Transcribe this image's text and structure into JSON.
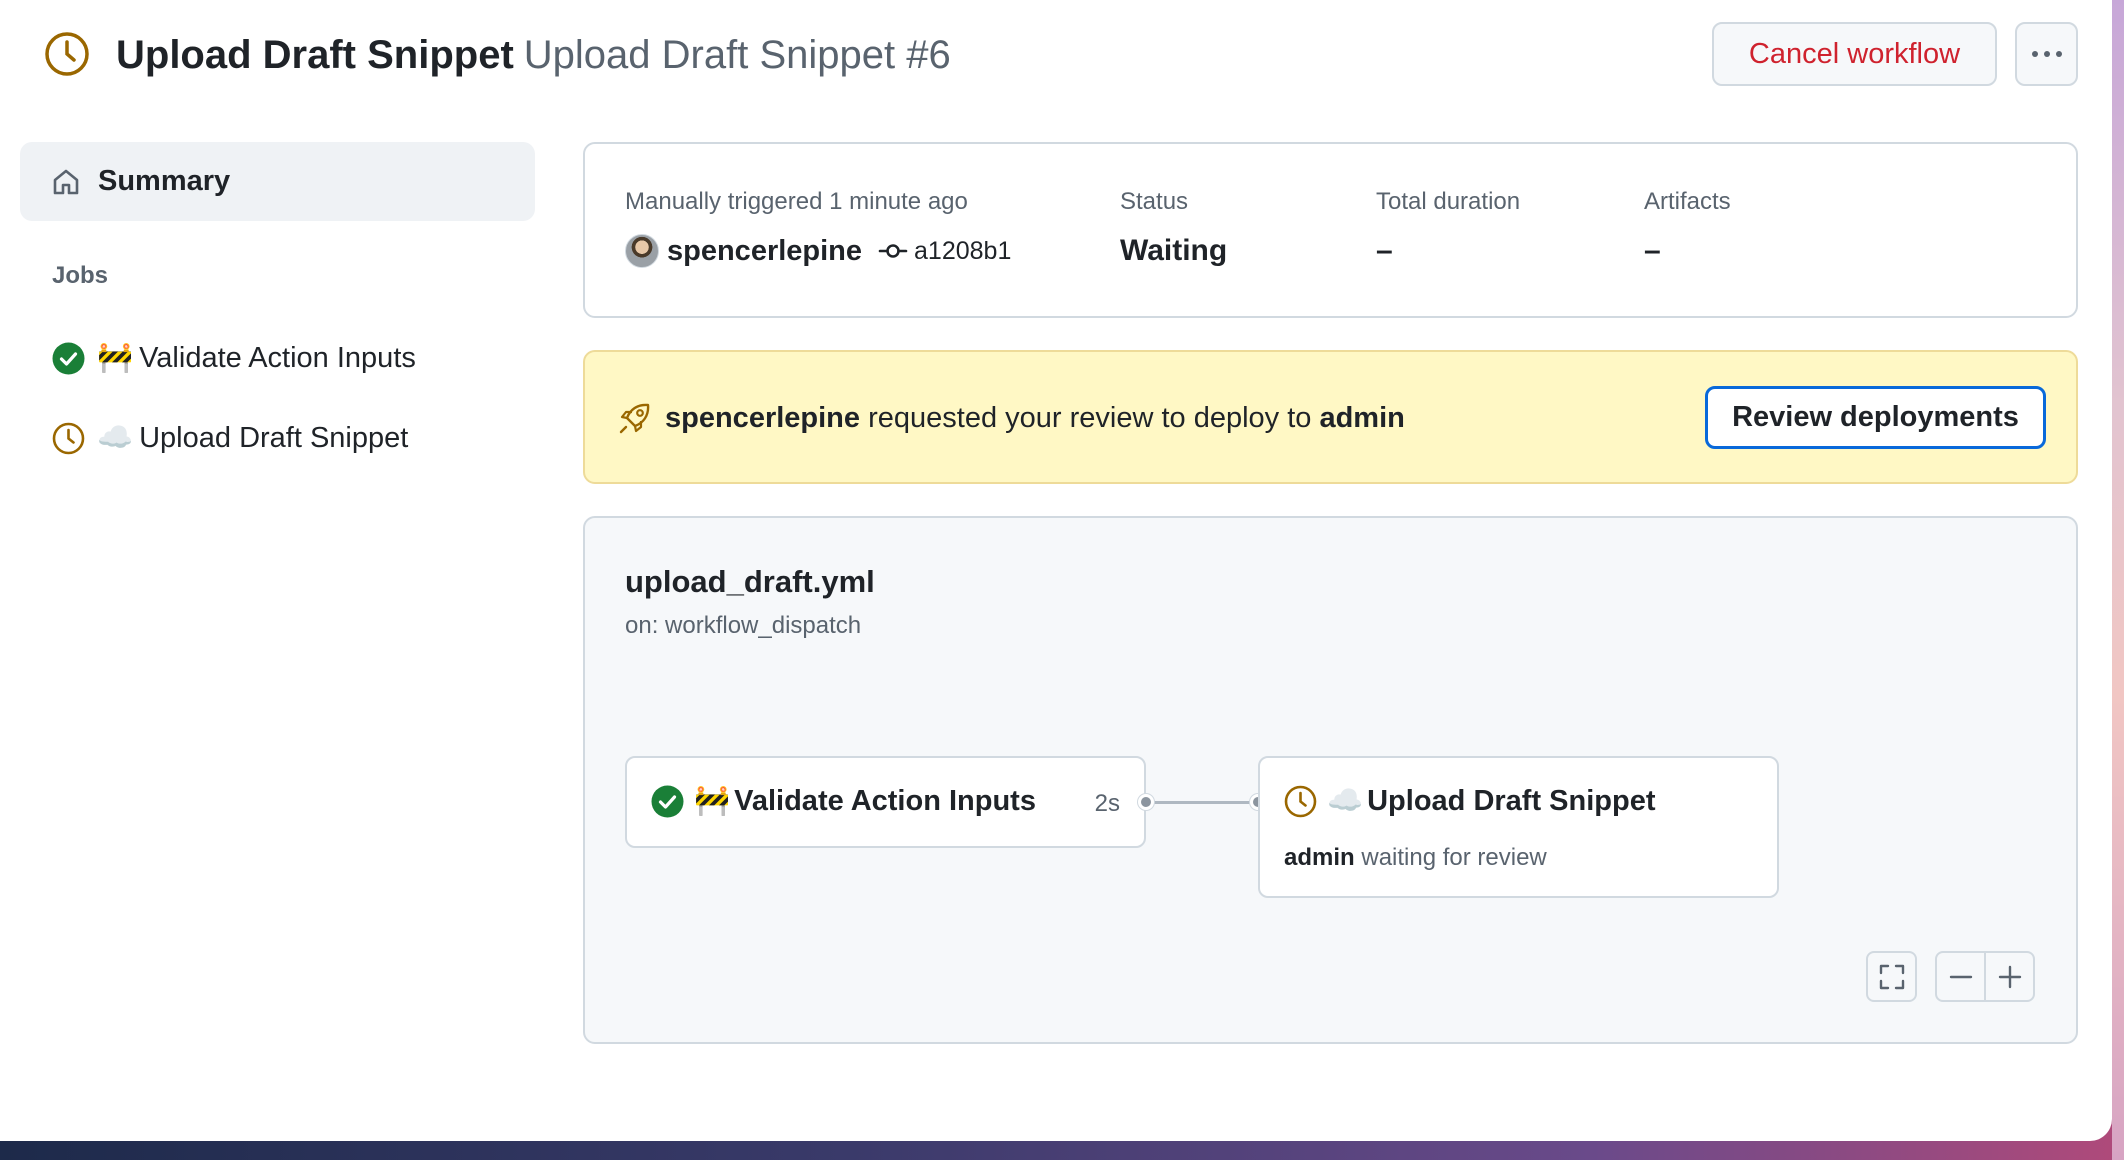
{
  "header": {
    "job_title": "Upload Draft Snippet",
    "run_title": "Upload Draft Snippet #6",
    "cancel_label": "Cancel workflow",
    "status_icon": "clock-icon",
    "more_icon": "kebab-horizontal-icon"
  },
  "sidebar": {
    "summary_label": "Summary",
    "summary_icon": "home-icon",
    "jobs_heading": "Jobs",
    "jobs": [
      {
        "emoji": "🚧",
        "label": "Validate Action Inputs",
        "status": "success",
        "icon": "check-circle-icon"
      },
      {
        "emoji": "☁️",
        "label": "Upload Draft Snippet",
        "status": "waiting",
        "icon": "clock-icon"
      }
    ]
  },
  "summary": {
    "trigger_label": "Manually triggered 1 minute ago",
    "actor": "spencerlepine",
    "commit": "a1208b1",
    "status_label": "Status",
    "status_value": "Waiting",
    "duration_label": "Total duration",
    "duration_value": "–",
    "artifacts_label": "Artifacts",
    "artifacts_value": "–"
  },
  "deploy_banner": {
    "user": "spencerlepine",
    "text": "requested your review to deploy to",
    "environment": "admin",
    "button_label": "Review deployments",
    "icon": "rocket-icon"
  },
  "graph": {
    "workflow_file": "upload_draft.yml",
    "trigger": "on: workflow_dispatch",
    "nodes": [
      {
        "emoji": "🚧",
        "label": "Validate Action Inputs",
        "duration": "2s",
        "status": "success"
      },
      {
        "emoji": "☁️",
        "label": "Upload Draft Snippet",
        "env": "admin",
        "sub_text": "waiting for review",
        "status": "waiting"
      }
    ]
  },
  "colors": {
    "accent": "#0969da",
    "danger": "#cf222e",
    "success": "#1a7f37",
    "waiting": "#9a6700",
    "banner_bg": "#fff8c5"
  }
}
